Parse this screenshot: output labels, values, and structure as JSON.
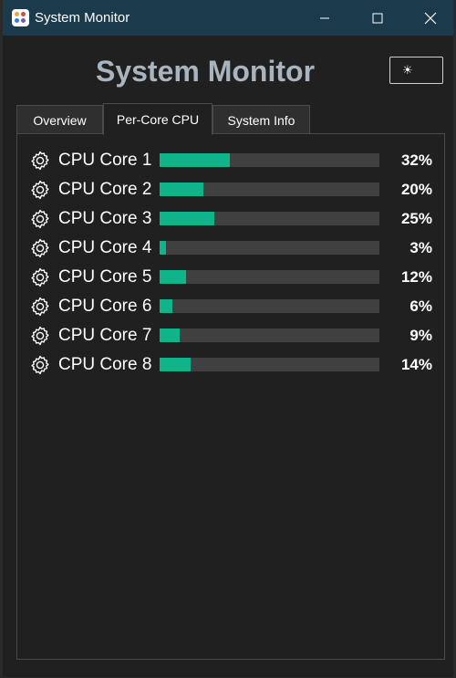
{
  "window": {
    "title": "System Monitor",
    "controls": {
      "minimize": "─",
      "maximize": "☐",
      "close": "✕"
    }
  },
  "app": {
    "title": "System Monitor",
    "theme_toggle_icon": "☀"
  },
  "tabs": [
    {
      "label": "Overview",
      "active": false
    },
    {
      "label": "Per-Core CPU",
      "active": true
    },
    {
      "label": "System Info",
      "active": false
    }
  ],
  "cores": [
    {
      "label": "CPU Core 1",
      "percent_text": "32%",
      "usage": 32
    },
    {
      "label": "CPU Core 2",
      "percent_text": "20%",
      "usage": 20
    },
    {
      "label": "CPU Core 3",
      "percent_text": "25%",
      "usage": 25
    },
    {
      "label": "CPU Core 4",
      "percent_text": "3%",
      "usage": 3
    },
    {
      "label": "CPU Core 5",
      "percent_text": "12%",
      "usage": 12
    },
    {
      "label": "CPU Core 6",
      "percent_text": "6%",
      "usage": 6
    },
    {
      "label": "CPU Core 7",
      "percent_text": "9%",
      "usage": 9
    },
    {
      "label": "CPU Core 8",
      "percent_text": "14%",
      "usage": 14
    }
  ],
  "colors": {
    "accent": "#0fb58a",
    "titlebar": "#1b3a4b",
    "title_text": "#aab4be"
  }
}
